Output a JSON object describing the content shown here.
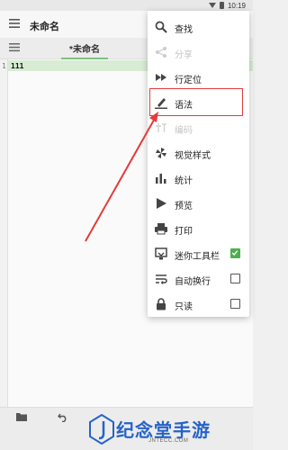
{
  "status_bar": {
    "time": "10:19"
  },
  "app_bar": {
    "title": "未命名"
  },
  "tab_bar": {
    "active_tab": "*未命名"
  },
  "editor": {
    "line_number": "1",
    "line_text": "111"
  },
  "menu": {
    "items": [
      {
        "label": "查找",
        "icon": "search-icon",
        "enabled": true
      },
      {
        "label": "分享",
        "icon": "share-icon",
        "enabled": false
      },
      {
        "label": "行定位",
        "icon": "goto-line-icon",
        "enabled": true
      },
      {
        "label": "语法",
        "icon": "pen-icon",
        "enabled": true,
        "highlighted": true
      },
      {
        "label": "编码",
        "icon": "encoding-icon",
        "enabled": false
      },
      {
        "label": "视觉样式",
        "icon": "pinwheel-icon",
        "enabled": true
      },
      {
        "label": "统计",
        "icon": "bar-chart-icon",
        "enabled": true
      },
      {
        "label": "预览",
        "icon": "play-icon",
        "enabled": true
      },
      {
        "label": "打印",
        "icon": "printer-icon",
        "enabled": true
      },
      {
        "label": "迷你工具栏",
        "icon": "mini-toolbar-icon",
        "enabled": true,
        "checked": true
      },
      {
        "label": "自动换行",
        "icon": "wrap-icon",
        "enabled": true,
        "checked": false
      },
      {
        "label": "只读",
        "icon": "lock-icon",
        "enabled": true,
        "checked": false
      }
    ]
  },
  "watermark": {
    "brand": "纪念堂手游",
    "sub": "JNTECC.COM"
  },
  "colors": {
    "accent": "#4caf50",
    "highlight": "#e53a3a",
    "watermark": "#2563c9"
  }
}
